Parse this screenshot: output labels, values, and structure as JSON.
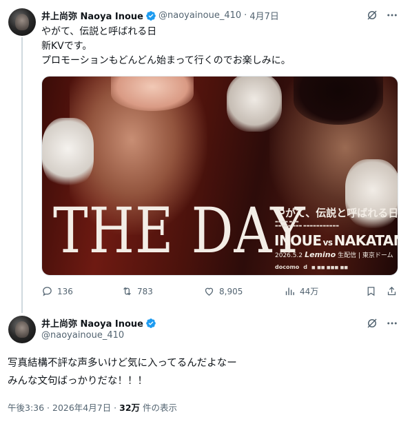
{
  "tweet1": {
    "display_name": "井上尚弥 Naoya Inoue",
    "handle": "@naoyainoue_410",
    "separator": "·",
    "date": "4月7日",
    "lines": [
      "やがて、伝説と呼ばれる日",
      "新KVです。",
      "プロモーションもどんどん始まって行くのでお楽しみに。"
    ],
    "poster": {
      "headline": "THE DAY",
      "tagline": "やがて、伝説と呼ばれる日。",
      "fighter_a": "INOUE",
      "vs": "vs",
      "fighter_b": "NAKATANI",
      "date": "2026.5.2",
      "broadcaster": "Lemino",
      "broadcast_note": "生配信 | 東京ドーム",
      "sponsor": "docomo",
      "sponsor2": "d"
    },
    "actions": {
      "replies": "136",
      "retweets": "783",
      "likes": "8,905",
      "views": "44万"
    }
  },
  "tweet2": {
    "display_name": "井上尚弥 Naoya Inoue",
    "handle": "@naoyainoue_410",
    "lines": [
      "写真結構不評な声多いけど気に入ってるんだよなー",
      "みんな文句ばっかりだな！！！"
    ],
    "time": "午後3:36 · 2026年4月7日 · ",
    "views_count": "32万",
    "views_label": " 件の表示"
  },
  "colors": {
    "text": "#0f1419",
    "muted": "#536471",
    "verified": "#1d9bf0",
    "thread_line": "#cfd9de"
  },
  "icons": [
    "grok-icon",
    "more-icon",
    "reply-icon",
    "retweet-icon",
    "like-icon",
    "views-icon",
    "bookmark-icon",
    "share-icon",
    "verified-icon"
  ]
}
